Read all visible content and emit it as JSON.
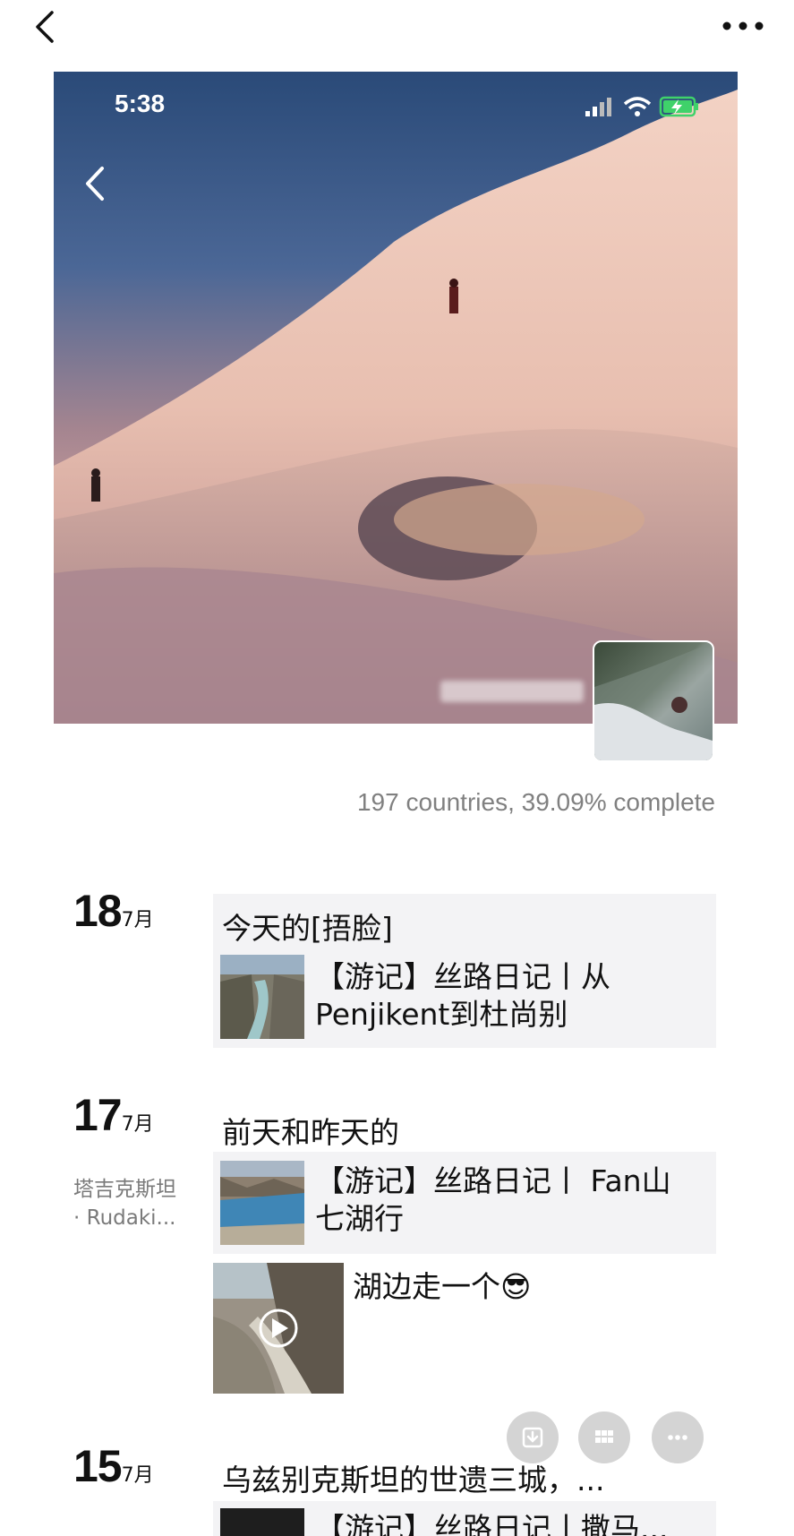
{
  "status_bar": {
    "time": "5:38"
  },
  "profile": {
    "progress_text": "197 countries, 39.09% complete"
  },
  "posts": [
    {
      "day": "18",
      "month": "7月",
      "text": "今天的[捂脸]",
      "link": {
        "line1": "【游记】丝路日记丨从",
        "line2": "Penjikent到杜尚别"
      }
    },
    {
      "day": "17",
      "month": "7月",
      "location_line1": "塔吉克斯坦",
      "location_line2": "· Rudaki...",
      "text": "前天和昨天的",
      "link": {
        "line1": "【游记】丝路日记丨 Fan山",
        "line2": "七湖行"
      },
      "video_caption": "湖边走一个😎"
    },
    {
      "day": "15",
      "month": "7月",
      "text": "乌兹别克斯坦的世遗三城，...",
      "link": {
        "line1": "【游记】丝路日记丨撒马..."
      }
    }
  ],
  "icons": {
    "back": "chevron-left-icon",
    "more": "more-dots-icon",
    "signal": "cell-signal-icon",
    "wifi": "wifi-icon",
    "battery": "battery-charging-icon",
    "play": "play-icon",
    "save": "save-icon",
    "grid": "grid-icon",
    "ellipsis": "ellipsis-icon"
  },
  "colors": {
    "accent_battery": "#3fd26a",
    "muted_text": "#808080"
  }
}
